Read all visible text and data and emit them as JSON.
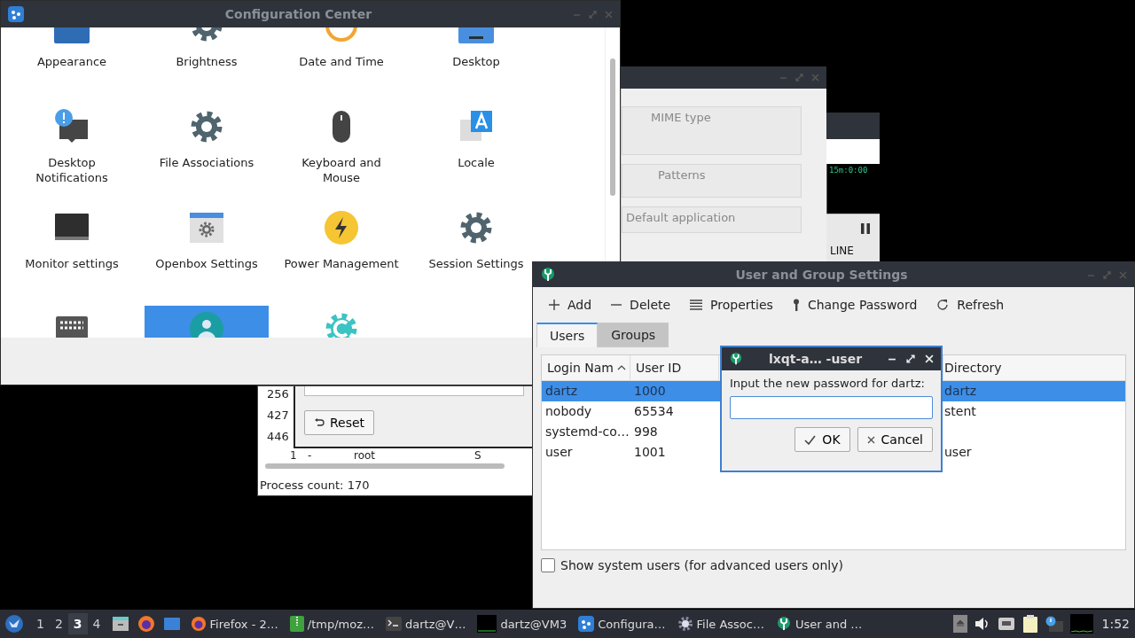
{
  "config_center": {
    "title": "Configuration Center",
    "items": [
      {
        "kind": "appearance",
        "label": "Appearance",
        "selected": false
      },
      {
        "kind": "brightness",
        "label": "Brightness",
        "selected": false
      },
      {
        "kind": "clock",
        "label": "Date and Time",
        "selected": false
      },
      {
        "kind": "desktop",
        "label": "Desktop",
        "selected": false
      },
      {
        "kind": "notification",
        "label": "Desktop Notifications",
        "selected": false
      },
      {
        "kind": "gear",
        "label": "File Associations",
        "selected": false
      },
      {
        "kind": "mouse",
        "label": "Keyboard and Mouse",
        "selected": false
      },
      {
        "kind": "locale",
        "label": "Locale",
        "selected": false
      },
      {
        "kind": "monitor",
        "label": "Monitor settings",
        "selected": false
      },
      {
        "kind": "openbox",
        "label": "Openbox Settings",
        "selected": false
      },
      {
        "kind": "power",
        "label": "Power Management",
        "selected": false
      },
      {
        "kind": "gear",
        "label": "Session Settings",
        "selected": false
      },
      {
        "kind": "keyboard",
        "selected": false
      },
      {
        "kind": "users",
        "selected": true
      },
      {
        "kind": "cgear",
        "selected": false
      }
    ]
  },
  "file_associations": {
    "fields": [
      "MIME type",
      "Patterns",
      "Default application"
    ]
  },
  "monitor_window": {
    "readout": "15m:0:00",
    "label": "LINE"
  },
  "process_window": {
    "pids": [
      "256",
      "427",
      "446"
    ],
    "reset_button": "Reset",
    "row": [
      "1",
      "-",
      "root",
      "S"
    ],
    "status": "Process count: 170"
  },
  "user_group": {
    "title": "User and Group Settings",
    "toolbar": [
      {
        "kind": "add",
        "label": "Add"
      },
      {
        "kind": "delete",
        "label": "Delete"
      },
      {
        "kind": "properties",
        "label": "Properties"
      },
      {
        "kind": "password",
        "label": "Change Password"
      },
      {
        "kind": "refresh",
        "label": "Refresh"
      }
    ],
    "tabs": [
      {
        "label": "Users",
        "selected": true
      },
      {
        "label": "Groups",
        "selected": false
      }
    ],
    "columns": [
      {
        "label": "Login Nam",
        "sorted": true
      },
      {
        "label": "User ID",
        "sorted": false
      },
      {
        "label": "Directory",
        "sorted": false
      }
    ],
    "rows": [
      {
        "login": "dartz",
        "uid": "1000",
        "home": "dartz",
        "selected": true
      },
      {
        "login": "nobody",
        "uid": "65534",
        "home": "stent",
        "selected": false
      },
      {
        "login": "systemd-co…",
        "uid": "998",
        "selected": false
      },
      {
        "login": "user",
        "uid": "1001",
        "home": "user",
        "selected": false
      }
    ],
    "show_system_users": {
      "label": "Show system users (for advanced users only)",
      "checked": false
    }
  },
  "password_dialog": {
    "title": "lxqt-a… -user",
    "prompt": "Input the new password for dartz:",
    "buttons": [
      {
        "kind": "ok",
        "label": "OK"
      },
      {
        "kind": "cancel",
        "label": "Cancel"
      }
    ]
  },
  "taskbar": {
    "desktops": [
      {
        "label": "1",
        "selected": false
      },
      {
        "label": "2",
        "selected": false
      },
      {
        "label": "3",
        "selected": true
      },
      {
        "label": "4",
        "selected": false
      }
    ],
    "tasks": [
      {
        "kind": "firefox",
        "label": "Firefox - 2…"
      },
      {
        "kind": "archive",
        "label": "/tmp/moz…"
      },
      {
        "kind": "terminal",
        "label": "dartz@V…"
      },
      {
        "kind": "blackterm",
        "label": "dartz@VM3"
      },
      {
        "kind": "config",
        "label": "Configura…"
      },
      {
        "kind": "gear",
        "label": "File Assoc…"
      },
      {
        "kind": "usertool",
        "label": "User and …"
      }
    ],
    "clock": "1:52"
  }
}
